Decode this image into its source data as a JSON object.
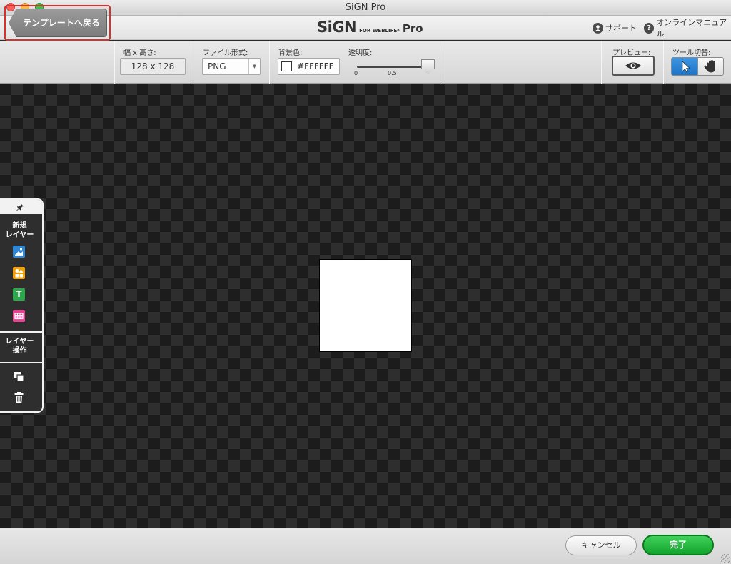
{
  "window": {
    "title": "SiGN Pro"
  },
  "brand": {
    "main": "SiGN",
    "sub": "FOR WEBLIFE*",
    "pro": "Pro"
  },
  "header_links": {
    "support": "サポート",
    "manual": "オンラインマニュアル"
  },
  "toolbar": {
    "back_label": "テンプレートへ戻る",
    "size_label": "幅 x 高さ:",
    "size_value": "128 x 128",
    "format_label": "ファイル形式:",
    "format_value": "PNG",
    "bg_label": "背景色:",
    "bg_value": "#FFFFFF",
    "opacity_label": "透明度:",
    "opacity_min": "0",
    "opacity_mid": "0.5",
    "opacity_value": 1,
    "preview_label": "プレビュー:",
    "tool_label": "ツール切替:",
    "active_tool": "select"
  },
  "left_panel": {
    "new_layer_title_1": "新規",
    "new_layer_title_2": "レイヤー",
    "layer_ops_title_1": "レイヤー",
    "layer_ops_title_2": "操作",
    "icons": [
      "pin-icon",
      "image-layer-icon",
      "shape-layer-icon",
      "text-layer-icon",
      "table-layer-icon",
      "duplicate-icon",
      "trash-icon"
    ]
  },
  "canvas": {
    "artboard_color": "#FFFFFF"
  },
  "footer": {
    "cancel_label": "キャンセル",
    "done_label": "完了"
  },
  "colors": {
    "accent_blue": "#1e74c6",
    "done_green": "#12a32b",
    "highlight_red": "#d9302e"
  }
}
